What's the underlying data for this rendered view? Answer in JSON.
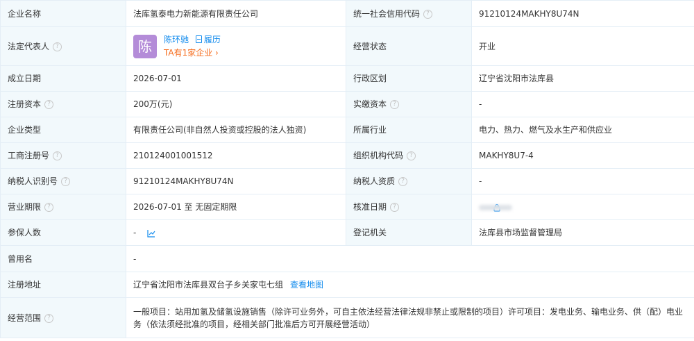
{
  "fields": {
    "company_name": {
      "label": "企业名称",
      "value": "法库氢泰电力新能源有限责任公司"
    },
    "credit_code": {
      "label": "统一社会信用代码",
      "value": "91210124MAKHY8U74N"
    },
    "legal_rep": {
      "label": "法定代表人",
      "avatar_char": "陈",
      "name": "陈环驰",
      "resume_label": "履历",
      "sub_text": "TA有1家企业 ›"
    },
    "biz_status": {
      "label": "经营状态",
      "value": "开业"
    },
    "est_date": {
      "label": "成立日期",
      "value": "2026-07-01"
    },
    "admin_region": {
      "label": "行政区划",
      "value": "辽宁省沈阳市法库县"
    },
    "reg_capital": {
      "label": "注册资本",
      "value": "200万(元)"
    },
    "paid_capital": {
      "label": "实缴资本",
      "value": "-"
    },
    "company_type": {
      "label": "企业类型",
      "value": "有限责任公司(非自然人投资或控股的法人独资)"
    },
    "industry": {
      "label": "所属行业",
      "value": "电力、热力、燃气及水生产和供应业"
    },
    "biz_reg_no": {
      "label": "工商注册号",
      "value": "210124001001512"
    },
    "org_code": {
      "label": "组织机构代码",
      "value": "MAKHY8U7-4"
    },
    "taxpayer_id": {
      "label": "纳税人识别号",
      "value": "91210124MAKHY8U74N"
    },
    "taxpayer_qual": {
      "label": "纳税人资质",
      "value": "-"
    },
    "biz_term": {
      "label": "营业期限",
      "value": "2026-07-01 至 无固定期限"
    },
    "approve_date": {
      "label": "核准日期"
    },
    "insured": {
      "label": "参保人数",
      "value": "-"
    },
    "reg_authority": {
      "label": "登记机关",
      "value": "法库县市场监督管理局"
    },
    "former_name": {
      "label": "曾用名",
      "value": "-"
    },
    "reg_address": {
      "label": "注册地址",
      "value": "辽宁省沈阳市法库县双台子乡关家屯七组",
      "map_link": "查看地图"
    },
    "biz_scope": {
      "label": "经营范围",
      "value": "一般项目：站用加氢及储氢设施销售（除许可业务外，可自主依法经营法律法规非禁止或限制的项目）许可项目：发电业务、输电业务、供（配）电业务（依法须经批准的项目，经相关部门批准后方可开展经营活动）"
    }
  },
  "icons": {
    "help": "question-circle-icon",
    "trend": "line-chart-icon",
    "lock": "lock-icon",
    "resume": "document-icon"
  },
  "colors": {
    "label_bg": "#f2f9fc",
    "border": "#e4eef6",
    "link": "#128bed",
    "orange": "#f56c1d",
    "avatar_bg": "#b48cd8"
  }
}
